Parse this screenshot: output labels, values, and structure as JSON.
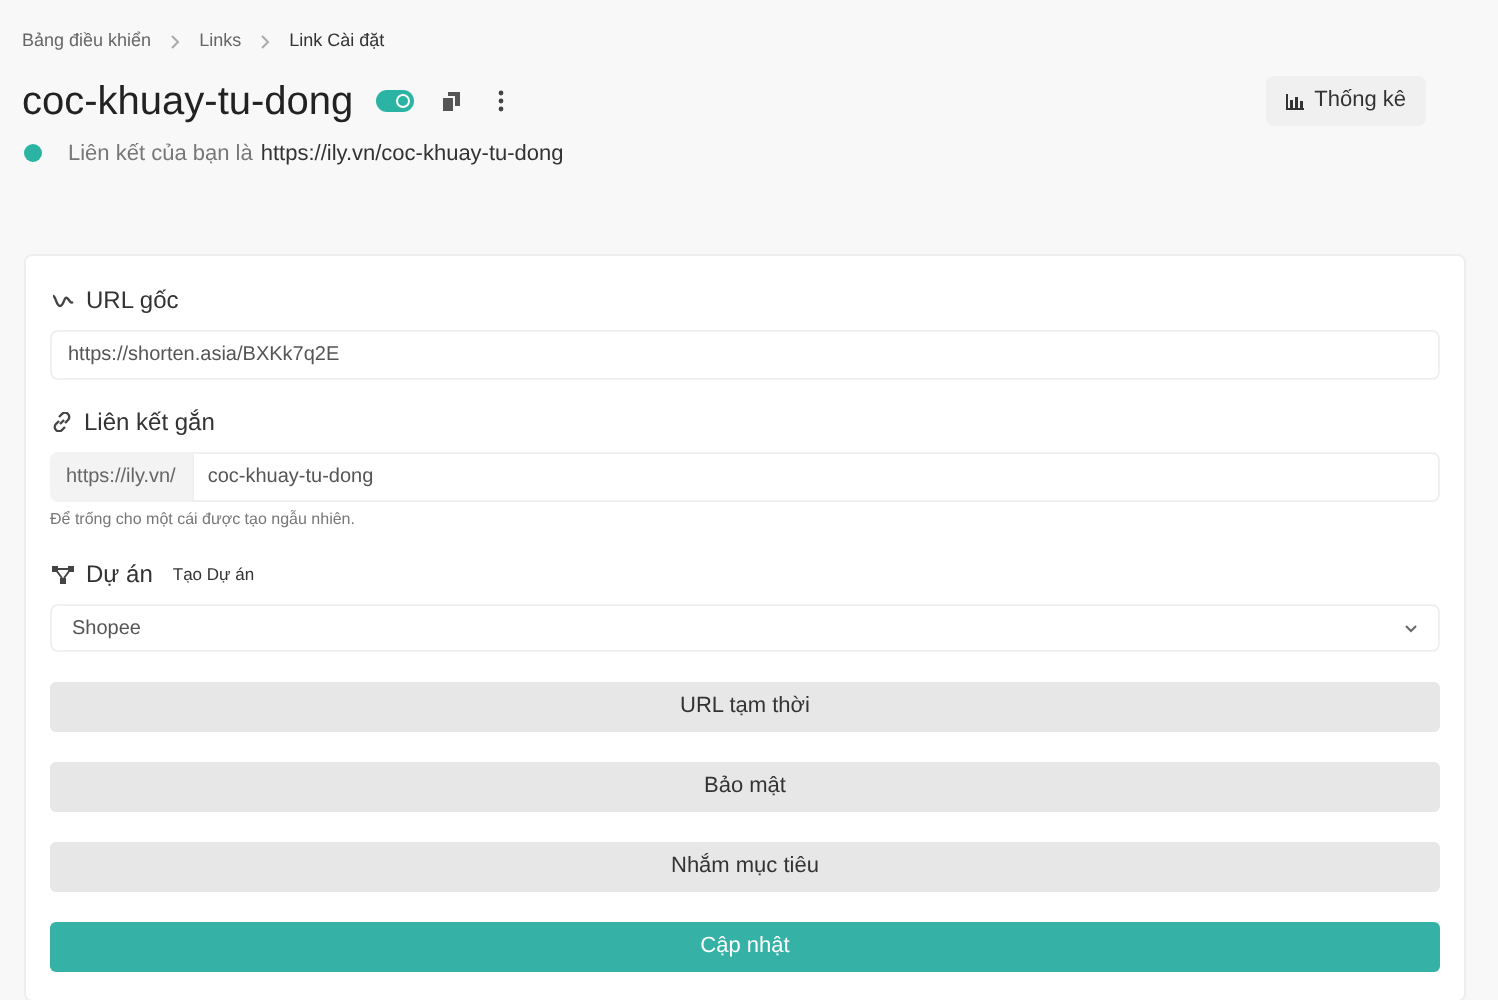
{
  "breadcrumb": [
    "Bảng điều khiển",
    "Links",
    "Link Cài đặt"
  ],
  "header": {
    "title": "coc-khuay-tu-dong",
    "enabled": true,
    "status_text": "Liên kết của bạn là",
    "status_url": "https://ily.vn/coc-khuay-tu-dong",
    "stats_button": "Thống kê"
  },
  "form": {
    "original_url": {
      "label": "URL gốc",
      "value": "https://shorten.asia/BXKk7q2E"
    },
    "short_link": {
      "label": "Liên kết gắn",
      "prefix": "https://ily.vn/",
      "value": "coc-khuay-tu-dong",
      "hint": "Để trống cho một cái được tạo ngẫu nhiên."
    },
    "project": {
      "label": "Dự án",
      "create_link": "Tạo Dự án",
      "value": "Shopee"
    },
    "sections": [
      "URL tạm thời",
      "Bảo mật",
      "Nhắm mục tiêu"
    ],
    "submit": "Cập nhật"
  }
}
